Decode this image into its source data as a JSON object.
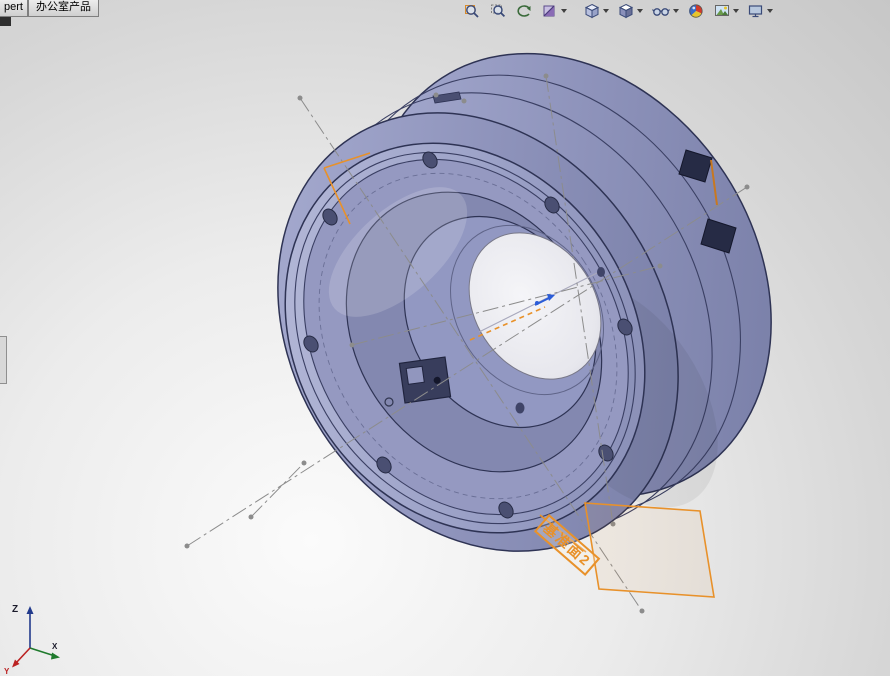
{
  "window": {
    "tabs": [
      {
        "label": "pert"
      },
      {
        "label": "办公室产品"
      }
    ]
  },
  "toolbar": {
    "icons": [
      {
        "name": "zoom-to-fit"
      },
      {
        "name": "zoom-to-area"
      },
      {
        "name": "previous-view"
      },
      {
        "name": "section-view"
      },
      {
        "name": "view-orientation"
      },
      {
        "name": "display-style"
      },
      {
        "name": "hide-show-items"
      },
      {
        "name": "edit-appearance"
      },
      {
        "name": "apply-scene"
      },
      {
        "name": "view-settings"
      }
    ]
  },
  "viewport": {
    "annotations": {
      "datum_plane_label": "基准面2"
    },
    "triad": {
      "x": "X",
      "y": "Y",
      "z": "Z"
    }
  },
  "colors": {
    "accent_orange": "#E8912A",
    "model_base": "#9196BE",
    "model_edge": "#2E3354",
    "centerline_gray": "#8C8C8C",
    "bg_top": "#C7C7C7",
    "bg_bottom": "#FBFBFB"
  }
}
